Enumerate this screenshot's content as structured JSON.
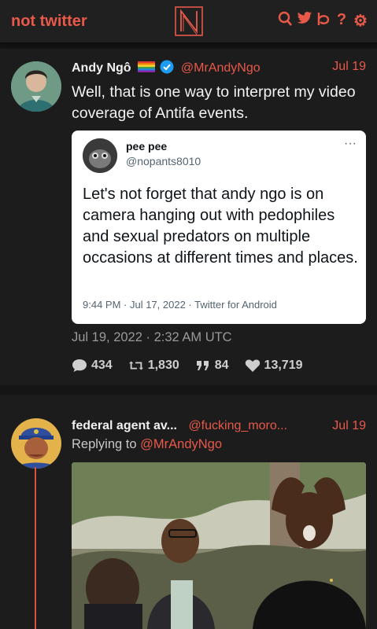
{
  "header": {
    "brand": "not twitter",
    "logo_letter": "N",
    "icons": [
      "search-icon",
      "twitter-bird-icon",
      "rocket-icon",
      "help-icon",
      "settings-icon"
    ],
    "icon_glyphs": [
      "Q",
      "",
      "lp",
      "?",
      "⚙"
    ]
  },
  "tweet": {
    "author_name": "Andy Ngô",
    "author_flag": "rainbow-flag-icon",
    "handle": "@MrAndyNgo",
    "date": "Jul 19",
    "text": "Well, that is one way to interpret my video coverage of Antifa events.",
    "timestamp": "Jul 19, 2022 · 2:32 AM UTC",
    "stats": {
      "replies": "434",
      "retweets": "1,830",
      "quotes": "84",
      "likes": "13,719"
    }
  },
  "embedded_tweet": {
    "name": "pee pee",
    "handle": "@nopants8010",
    "more": "···",
    "text": "Let's not forget that andy ngo is on camera hanging out with pedophiles and sexual predators on multiple occasions at different times and places.",
    "footer": "9:44 PM · Jul 17, 2022 · Twitter for Android"
  },
  "reply": {
    "author_name": "federal agent av...",
    "handle": "@fucking_moro...",
    "date": "Jul 19",
    "replying_prefix": "Replying to",
    "replying_to": "@MrAndyNgo"
  },
  "colors": {
    "accent": "#e8594a",
    "background": "#141414",
    "card": "#1c1c1c"
  }
}
